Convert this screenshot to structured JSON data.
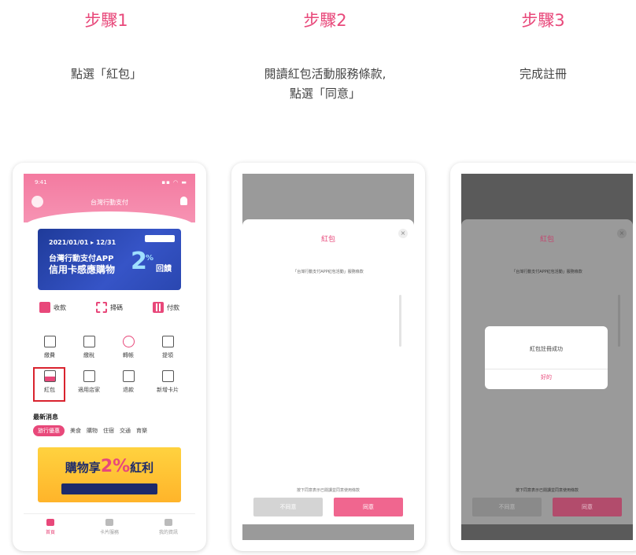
{
  "steps": [
    {
      "title": "步驟1",
      "desc_line1": "點選「紅包」",
      "desc_line2": ""
    },
    {
      "title": "步驟2",
      "desc_line1": "閱讀紅包活動服務條款,",
      "desc_line2": "點選「同意」"
    },
    {
      "title": "步驟3",
      "desc_line1": "完成註冊",
      "desc_line2": ""
    }
  ],
  "phone1": {
    "status_time": "9:41",
    "status_icons": "▪▪ ◠ ▬",
    "header_title": "台灣行動支付",
    "banner": {
      "date": "2021/01/01 ▸ 12/31",
      "line1": "台灣行動支付APP",
      "line2": "信用卡感應購物",
      "big": "2",
      "pct": "%",
      "reward": "回饋"
    },
    "quick_actions": {
      "receive": "收款",
      "scan": "掃碼",
      "pay": "付款"
    },
    "grid": [
      "繳費",
      "繳稅",
      "轉帳",
      "提領",
      "紅包",
      "適用店家",
      "退款",
      "新增卡片"
    ],
    "news_title": "最新消息",
    "chips": [
      "旅行優惠",
      "美食",
      "購物",
      "住宿",
      "交通",
      "育樂"
    ],
    "promo": {
      "text": "購物享",
      "big": "2%",
      "suffix": "紅利"
    },
    "tabs": [
      "首頁",
      "卡片服務",
      "我的資訊"
    ]
  },
  "phone2": {
    "sheet_title": "紅包",
    "close": "×",
    "terms_title": "「台灣行動支付APP紅包活動」服務條款",
    "foot_note": "按下同意表示已閱讀並同意使用條款",
    "btn_decline": "不同意",
    "btn_agree": "同意"
  },
  "phone3": {
    "sheet_title": "紅包",
    "close": "×",
    "terms_title": "「台灣行動支付APP紅包活動」服務條款",
    "dialog_msg": "紅包註冊成功",
    "dialog_ok": "好的",
    "foot_note": "按下同意表示已閱讀並同意使用條款",
    "btn_decline": "不同意",
    "btn_agree": "同意"
  },
  "colors": {
    "accent": "#e8487a",
    "highlight": "#d9232e"
  }
}
